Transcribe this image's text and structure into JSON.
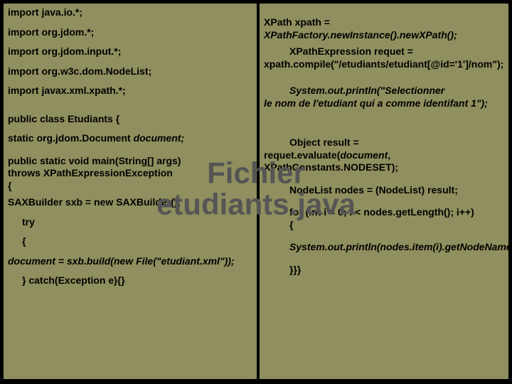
{
  "title_line1": "Fichier",
  "title_line2": "etudiants.java",
  "left": {
    "imp1": "import java.io.*;",
    "imp2": "import org.jdom.*;",
    "imp3": "import org.jdom.input.*;",
    "imp4": "import org.w3c.dom.NodeList;",
    "imp5": "import javax.xml.xpath.*;",
    "classline": "public class Etudiants {",
    "static_pre": " static org.jdom.Document ",
    "static_doc": "document;",
    "main1": "public static void main(String[] args) ",
    "main2": "throws XPathExpressionException",
    "main3": "{",
    "sax": "SAXBuilder sxb = new SAXBuilder();",
    "try": "try",
    "open": "{",
    "build1": "document = sxb.build(new File(\"etudiant.xml\"));",
    "catch": "} catch(Exception e){}"
  },
  "right": {
    "xp1a": " XPath xpath = ",
    "xp1b": "XPathFactory.newInstance().newXPath();",
    "xp2a": "XPathExpression requet = ",
    "xp2b": "xpath.compile(\"/etudiants/etudiant[@id='1']/nom\");",
    "sop1a": "System.out.println(\"Selectionner ",
    "sop1b": "le nom de l'etudiant qui a comme identifant 1\");",
    "res1": "Object result = ",
    "res2a": "requet.evaluate(",
    "res2b": "document",
    "res2c": ", XPathConstants.NODESET);",
    "nodes": "NodeList nodes = (NodeList) result;",
    "for1": "for (int i = 0; i < nodes.getLength(); i++)",
    "for2": "{",
    "sop2": "System.out.println(nodes.item(i).getNodeName());",
    "close": "}}}"
  }
}
